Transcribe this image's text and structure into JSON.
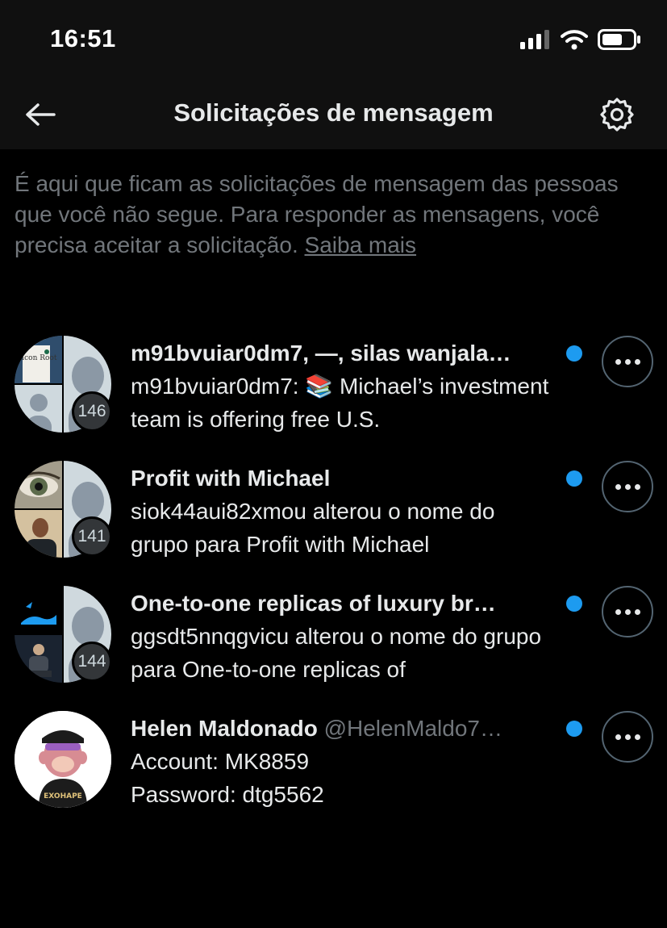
{
  "status_bar": {
    "time": "16:51"
  },
  "header": {
    "title": "Solicitações de mensagem"
  },
  "info": {
    "text": "É aqui que ficam as solicitações de mensagem das pessoas que você não segue. Para responder as mensagens, você precisa aceitar a solicitação.",
    "link": "Saiba mais"
  },
  "requests": [
    {
      "title": "m91bvuiar0dm7, —, silas wanjala…",
      "handle": "",
      "message": "m91bvuiar0dm7: 📚 Michael’s investment team is offering free U.S.",
      "count": "146",
      "avatar_label": "Yacon Root",
      "unread": true
    },
    {
      "title": "Profit with Michael",
      "handle": "",
      "message": "siok44aui82xmou alterou o nome do grupo para Profit with Michael",
      "count": "141",
      "unread": true
    },
    {
      "title": "One-to-one replicas of luxury br…",
      "handle": "",
      "message": "ggsdt5nnqgvicu alterou o nome do grupo para One-to-one replicas of",
      "count": "144",
      "unread": true
    },
    {
      "title": "Helen Maldonado",
      "handle": "@HelenMaldo7…",
      "message": "Account: MK8859\nPassword: dtg5562",
      "avatar_label": "EXOHAPE",
      "unread": true
    }
  ],
  "colors": {
    "background": "#000000",
    "bar": "#101010",
    "text": "#e7e9ea",
    "muted": "#71767b",
    "accent": "#1d9bf0"
  }
}
